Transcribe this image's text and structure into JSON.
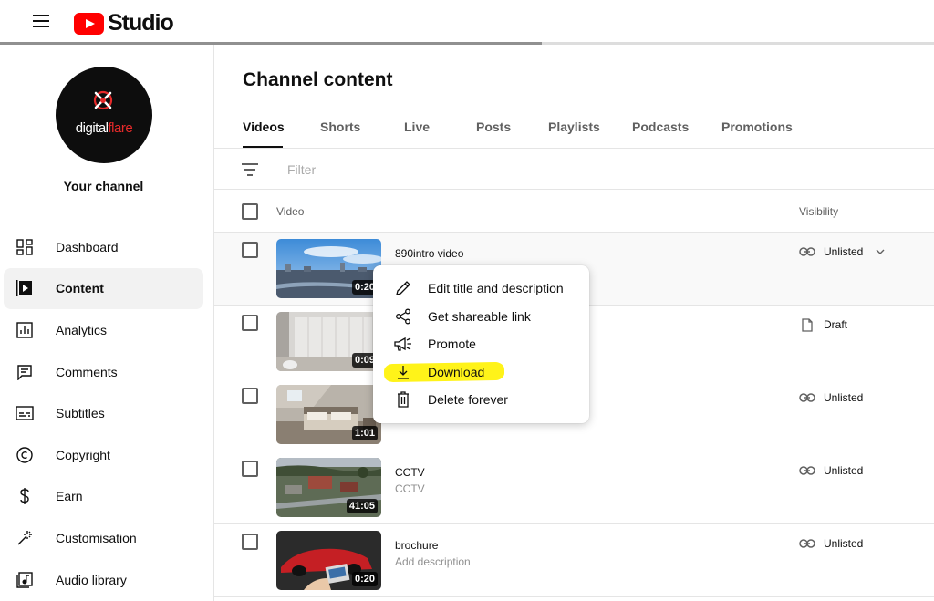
{
  "app": {
    "logo_text": "Studio",
    "progress_fraction": 0.58
  },
  "sidebar": {
    "channel_logo": {
      "prefix": "digital",
      "suffix": "flare"
    },
    "channel_label": "Your channel",
    "items": [
      {
        "label": "Dashboard",
        "icon": "dashboard-icon"
      },
      {
        "label": "Content",
        "icon": "content-icon",
        "active": true
      },
      {
        "label": "Analytics",
        "icon": "analytics-icon"
      },
      {
        "label": "Comments",
        "icon": "comments-icon"
      },
      {
        "label": "Subtitles",
        "icon": "subtitles-icon"
      },
      {
        "label": "Copyright",
        "icon": "copyright-icon"
      },
      {
        "label": "Earn",
        "icon": "dollar-icon"
      },
      {
        "label": "Customisation",
        "icon": "magic-wand-icon"
      },
      {
        "label": "Audio library",
        "icon": "audio-library-icon"
      }
    ]
  },
  "main": {
    "title": "Channel content",
    "tabs": [
      {
        "label": "Videos",
        "active": true
      },
      {
        "label": "Shorts"
      },
      {
        "label": "Live"
      },
      {
        "label": "Posts"
      },
      {
        "label": "Playlists"
      },
      {
        "label": "Podcasts"
      },
      {
        "label": "Promotions"
      }
    ],
    "filter_placeholder": "Filter",
    "table": {
      "col_video": "Video",
      "col_visibility": "Visibility"
    },
    "rows": [
      {
        "title": "890intro video",
        "description": "",
        "duration": "0:20",
        "visibility": "Unlisted",
        "visibility_icon": "link-icon"
      },
      {
        "title": "",
        "description": "",
        "duration": "0:09",
        "visibility": "Draft",
        "visibility_icon": "document-icon"
      },
      {
        "title": "",
        "description": "",
        "duration": "1:01",
        "visibility": "Unlisted",
        "visibility_icon": "link-icon"
      },
      {
        "title": "CCTV",
        "description": "CCTV",
        "duration": "41:05",
        "visibility": "Unlisted",
        "visibility_icon": "link-icon"
      },
      {
        "title": "brochure",
        "description": "Add description",
        "duration": "0:20",
        "visibility": "Unlisted",
        "visibility_icon": "link-icon"
      }
    ]
  },
  "context_menu": {
    "items": [
      {
        "label": "Edit title and description",
        "icon": "pencil-icon"
      },
      {
        "label": "Get shareable link",
        "icon": "share-icon"
      },
      {
        "label": "Promote",
        "icon": "megaphone-icon"
      },
      {
        "label": "Download",
        "icon": "download-icon",
        "highlighted": true,
        "highlight_color": "#fff200"
      },
      {
        "label": "Delete forever",
        "icon": "trash-icon"
      }
    ]
  },
  "colors": {
    "brand_red": "#ff0000",
    "highlight": "#fff200"
  }
}
